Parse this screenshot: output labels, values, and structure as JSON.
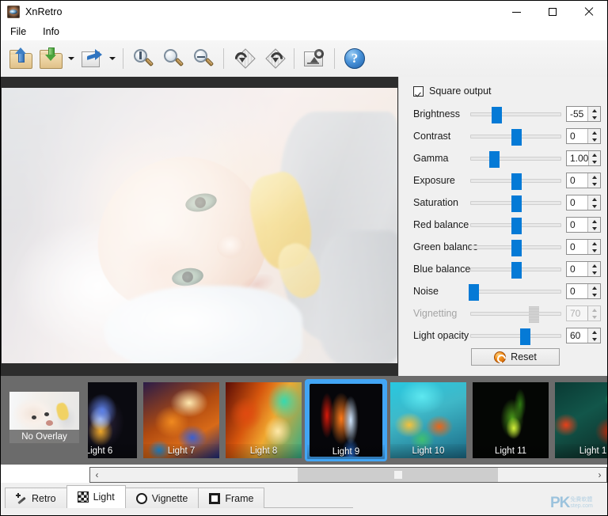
{
  "window": {
    "title": "XnRetro",
    "app_icon": "camera-lens-icon",
    "minimize": "–",
    "maximize": "□",
    "close": "✕"
  },
  "menubar": {
    "items": [
      {
        "label": "File"
      },
      {
        "label": "Info"
      }
    ]
  },
  "toolbar": {
    "buttons": [
      {
        "name": "open-file-button",
        "icon": "folder-open-icon",
        "dropdown": false
      },
      {
        "name": "save-file-button",
        "icon": "folder-save-icon",
        "dropdown": true
      },
      {
        "name": "export-button",
        "icon": "export-share-icon",
        "dropdown": true
      },
      {
        "name": "zoom-in-button",
        "icon": "zoom-in-icon",
        "dropdown": false
      },
      {
        "name": "zoom-out-button",
        "icon": "zoom-out-icon",
        "dropdown": false
      },
      {
        "name": "zoom-fit-button",
        "icon": "zoom-actual-size-icon",
        "dropdown": false
      },
      {
        "name": "rotate-left-button",
        "icon": "rotate-left-icon",
        "dropdown": false
      },
      {
        "name": "rotate-right-button",
        "icon": "rotate-right-icon",
        "dropdown": false
      },
      {
        "name": "batch-button",
        "icon": "batch-convert-icon",
        "dropdown": false
      },
      {
        "name": "help-button",
        "icon": "help-question-icon",
        "dropdown": false
      }
    ]
  },
  "preview": {
    "alt": "baby-photo-preview"
  },
  "settings": {
    "square_output": {
      "label": "Square output",
      "checked": true
    },
    "sliders": [
      {
        "label": "Brightness",
        "value": "-55",
        "percent": 28,
        "disabled": false
      },
      {
        "label": "Contrast",
        "value": "0",
        "percent": 50,
        "disabled": false
      },
      {
        "label": "Gamma",
        "value": "1.00",
        "percent": 26,
        "disabled": false
      },
      {
        "label": "Exposure",
        "value": "0",
        "percent": 50,
        "disabled": false
      },
      {
        "label": "Saturation",
        "value": "0",
        "percent": 50,
        "disabled": false
      },
      {
        "label": "Red balance",
        "value": "0",
        "percent": 50,
        "disabled": false
      },
      {
        "label": "Green balance",
        "value": "0",
        "percent": 50,
        "disabled": false
      },
      {
        "label": "Blue balance",
        "value": "0",
        "percent": 50,
        "disabled": false
      },
      {
        "label": "Noise",
        "value": "0",
        "percent": 3,
        "disabled": false
      },
      {
        "label": "Vignetting",
        "value": "70",
        "percent": 70,
        "disabled": true
      },
      {
        "label": "Light opacity",
        "value": "60",
        "percent": 60,
        "disabled": false
      }
    ],
    "reset_button": {
      "label": "Reset",
      "icon": "reset-circular-arrow-icon"
    }
  },
  "filmstrip": {
    "no_overlay": {
      "label": "No Overlay",
      "selected": false
    },
    "thumbnails": [
      {
        "label": "Light 6",
        "selected": false,
        "swatch": "g6"
      },
      {
        "label": "Light 7",
        "selected": false,
        "swatch": "g7"
      },
      {
        "label": "Light 8",
        "selected": false,
        "swatch": "g8"
      },
      {
        "label": "Light 9",
        "selected": true,
        "swatch": "g9"
      },
      {
        "label": "Light 10",
        "selected": false,
        "swatch": "g10"
      },
      {
        "label": "Light 11",
        "selected": false,
        "swatch": "g11"
      },
      {
        "label": "Light 1",
        "selected": false,
        "swatch": "g12"
      }
    ],
    "scrollbar": {
      "left_arrow": "‹",
      "right_arrow": "›"
    }
  },
  "tabs": [
    {
      "label": "Retro",
      "icon": "magic-wand-icon",
      "active": false
    },
    {
      "label": "Light",
      "icon": "checkerboard-icon",
      "active": true
    },
    {
      "label": "Vignette",
      "icon": "circle-outline-icon",
      "active": false
    },
    {
      "label": "Frame",
      "icon": "square-frame-icon",
      "active": false
    }
  ],
  "watermark": {
    "text": "PK",
    "sub": "免費軟體\nstep.com"
  },
  "colors": {
    "accent": "#057ad6",
    "selection": "#42a5f5",
    "panel_bg": "#f0f0f0",
    "canvas_bg": "#2d2d2d",
    "strip_bg": "#6b6b6b",
    "reset_icon": "#f08c1a"
  }
}
